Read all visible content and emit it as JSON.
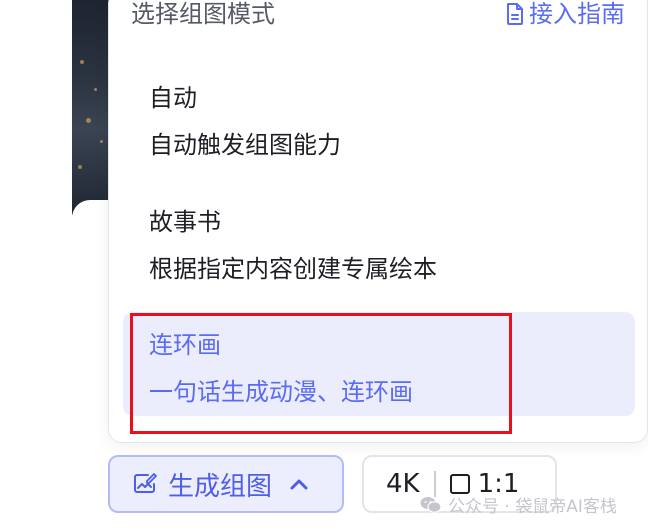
{
  "dropdown": {
    "title": "选择组图模式",
    "guide_link": "接入指南",
    "options": [
      {
        "title": "自动",
        "description": "自动触发组图能力",
        "selected": false
      },
      {
        "title": "故事书",
        "description": "根据指定内容创建专属绘本",
        "selected": false
      },
      {
        "title": "连环画",
        "description": "一句话生成动漫、连环画",
        "selected": true
      }
    ]
  },
  "toolbar": {
    "generate_label": "生成组图",
    "resolution": "4K",
    "aspect_ratio": "1:1"
  },
  "watermark": {
    "text": "公众号 · 袋鼠帝AI客栈"
  },
  "colors": {
    "accent": "#5b6cf2",
    "selected_bg": "#ebedfd",
    "highlight": "#e8101a"
  },
  "icons": {
    "guide": "document-icon",
    "generate": "image-edit-icon",
    "toggle": "chevron-up-icon",
    "ratio": "square-icon",
    "watermark": "wechat-icon"
  }
}
